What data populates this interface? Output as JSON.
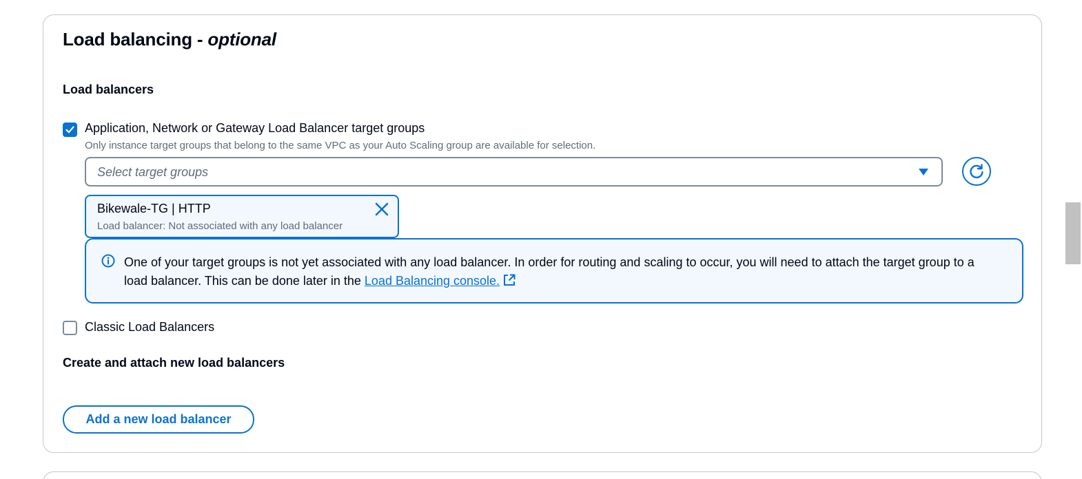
{
  "panel": {
    "title": "Load balancing - ",
    "title_optional": "optional"
  },
  "load_balancers": {
    "heading": "Load balancers",
    "alb_option": {
      "label": "Application, Network or Gateway Load Balancer target groups",
      "description": "Only instance target groups that belong to the same VPC as your Auto Scaling group are available for selection.",
      "checked": true
    },
    "target_select": {
      "placeholder": "Select target groups"
    },
    "selected_token": {
      "title": "Bikewale-TG | HTTP",
      "subtitle": "Load balancer: Not associated with any load balancer"
    },
    "alert": {
      "text": "One of your target groups is not yet associated with any load balancer. In order for routing and scaling to occur, you will need to attach the target group to a load balancer. This can be done later in the ",
      "link": "Load Balancing console."
    },
    "classic_option": {
      "label": "Classic Load Balancers",
      "checked": false
    }
  },
  "create_section": {
    "heading": "Create and attach new load balancers",
    "add_button": "Add a new load balancer"
  },
  "colors": {
    "accent": "#0972d3",
    "info_bg": "#f2f8fd",
    "border": "#c6c6cd",
    "text": "#000716",
    "muted": "#5f6b7a"
  },
  "icons": [
    "check-icon",
    "caret-down-icon",
    "refresh-icon",
    "close-icon",
    "info-icon",
    "external-link-icon"
  ]
}
